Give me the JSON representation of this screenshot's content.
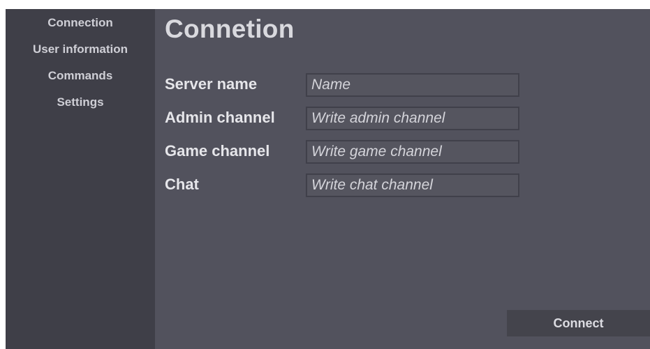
{
  "sidebar": {
    "items": [
      {
        "label": "Connection"
      },
      {
        "label": "User information"
      },
      {
        "label": "Commands"
      },
      {
        "label": "Settings"
      }
    ]
  },
  "main": {
    "title": "Connetion",
    "fields": [
      {
        "label": "Server name",
        "value": "",
        "placeholder": "Name"
      },
      {
        "label": "Admin channel",
        "value": "",
        "placeholder": "Write admin channel"
      },
      {
        "label": "Game channel",
        "value": "",
        "placeholder": "Write game channel"
      },
      {
        "label": "Chat",
        "value": "",
        "placeholder": "Write chat channel"
      }
    ],
    "connect_label": "Connect"
  },
  "colors": {
    "background": "#52525d",
    "sidebar": "#3f3f48",
    "input_border": "#40404a",
    "button": "#44444c"
  }
}
